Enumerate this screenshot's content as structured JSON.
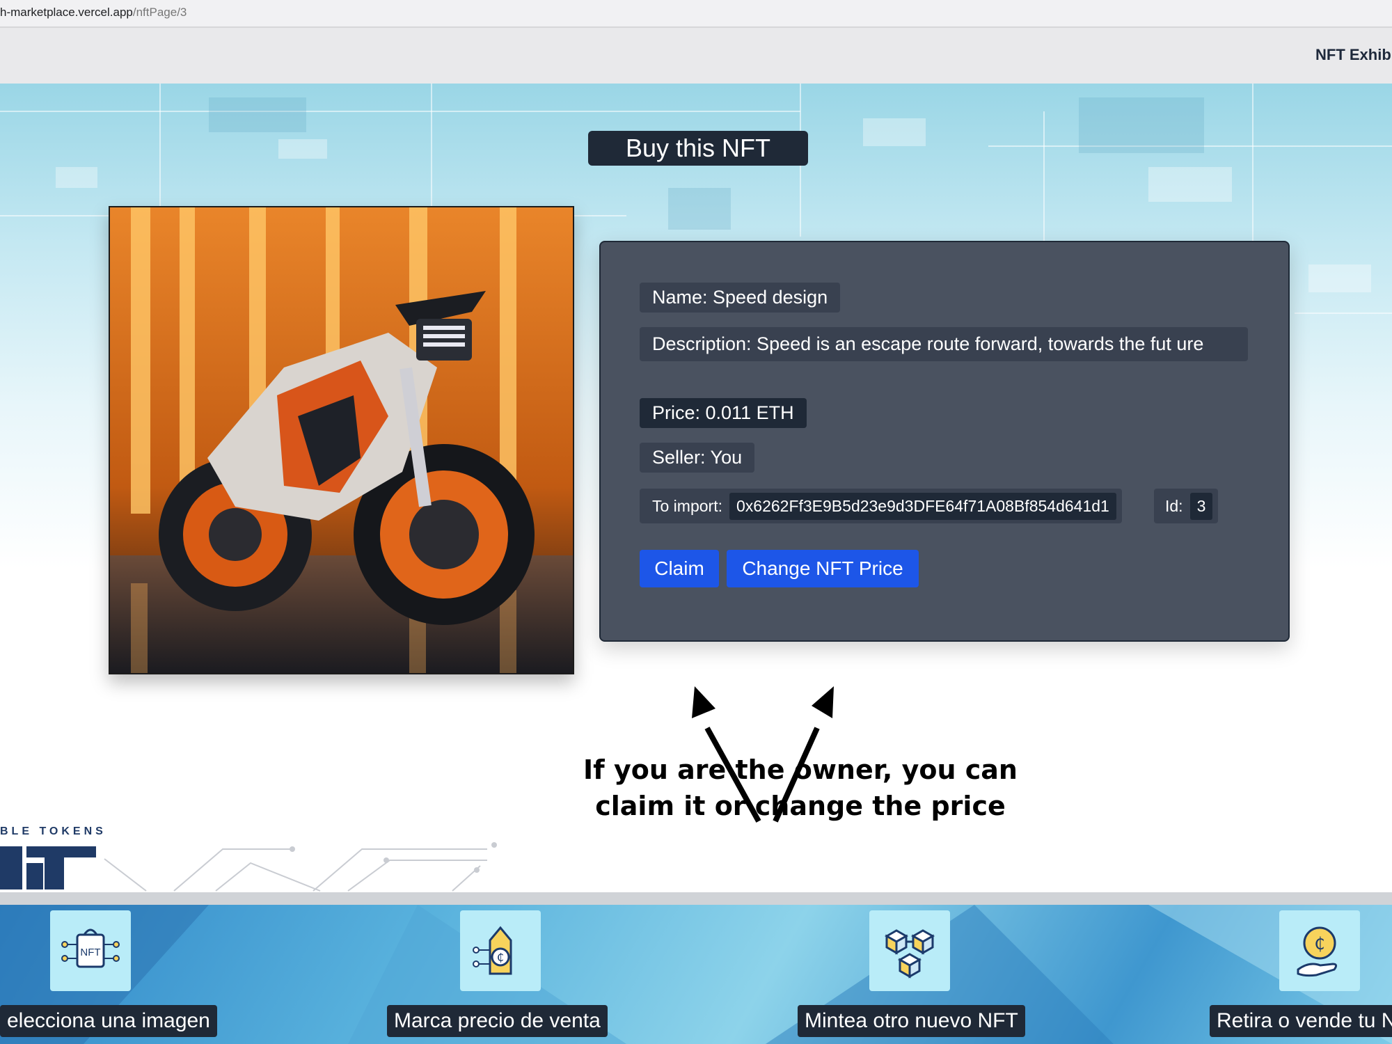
{
  "browser": {
    "url_host": "h-marketplace.vercel.app",
    "url_path": "/nftPage/3"
  },
  "navbar": {
    "link": "NFT Exhibi"
  },
  "page": {
    "title": "Buy this NFT"
  },
  "nft": {
    "name": "Name: Speed design",
    "description": "Description: Speed is an escape route forward, towards the fut ure",
    "price": "Price: 0.011 ETH",
    "seller": "Seller: You",
    "import_label": "To import:",
    "address": "0x6262Ff3E9B5d23e9d3DFE64f71A08Bf854d641d1",
    "id_label": "Id:",
    "id_value": "3"
  },
  "actions": {
    "claim": "Claim",
    "change_price": "Change NFT Price"
  },
  "annotation": {
    "line1": "If you are the owner, you can",
    "line2": "claim it or change the price"
  },
  "logo": {
    "tagline": "BLE TOKENS"
  },
  "footer": {
    "steps": [
      {
        "label": "elecciona una imagen",
        "icon": "nft-bag-icon"
      },
      {
        "label": "Marca precio de venta",
        "icon": "price-tag-icon"
      },
      {
        "label": "Mintea otro nuevo NFT",
        "icon": "blocks-icon"
      },
      {
        "label": "Retira o vende tu N",
        "icon": "coin-hand-icon"
      }
    ]
  },
  "colors": {
    "button_blue": "#1d56e8",
    "panel_gray": "#4a5260",
    "chip_dark": "#1f2937"
  }
}
